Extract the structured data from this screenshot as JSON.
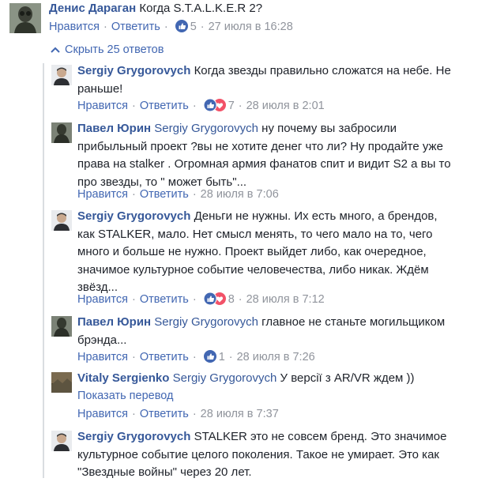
{
  "top_comment": {
    "author": "Денис Дараган",
    "text": "Когда S.T.A.L.K.E.R 2?",
    "like": "Нравится",
    "reply": "Ответить",
    "likes": "5",
    "time": "27 июля в 16:28"
  },
  "collapse_label": "Скрыть 25 ответов",
  "replies": [
    {
      "author": "Sergiy Grygorovych",
      "text": "Когда звезды правильно сложатся на небе. Не раньше!",
      "like": "Нравится",
      "reply": "Ответить",
      "likes": "7",
      "time": "28 июля в 2:01"
    },
    {
      "author": "Павел Юрин",
      "mention": "Sergiy Grygorovych",
      "text": "ну почему вы забросили прибыльный проект ?вы не хотите денег что ли? Ну продайте уже права на stalker . Огромная армия фанатов спит и видит S2 а вы то про звезды, то \" может быть\"...",
      "like": "Нравится",
      "reply": "Ответить",
      "time": "28 июля в 7:06"
    },
    {
      "author": "Sergiy Grygorovych",
      "text": "Деньги не нужны. Их есть много, а брендов, как STALKER, мало. Нет смысл менять, то чего мало на то, чего много и больше не нужно. Проект выйдет либо, как очередное, значимое культурное событие человечества, либо никак. Ждём звёзд...",
      "like": "Нравится",
      "reply": "Ответить",
      "likes": "8",
      "time": "28 июля в 7:12"
    },
    {
      "author": "Павел Юрин",
      "mention": "Sergiy Grygorovych",
      "text": "главное не станьте могильщиком брэнда...",
      "like": "Нравится",
      "reply": "Ответить",
      "likes": "1",
      "time": "28 июля в 7:26"
    },
    {
      "author": "Vitaly Sergienko",
      "mention": "Sergiy Grygorovych",
      "text": "У версії з AR/VR ждем ))",
      "translate": "Показать перевод",
      "like": "Нравится",
      "reply": "Ответить",
      "time": "28 июля в 7:37"
    },
    {
      "author": "Sergiy Grygorovych",
      "text": "STALKER это не совсем бренд. Это значимое культурное событие целого поколения. Такое не умирает. Это как \"Звездные войны\" через 20 лет."
    }
  ],
  "colors": {
    "link": "#4267b2",
    "name": "#365899",
    "meta": "#90949c",
    "like_blue": "#3b5998",
    "heart_red": "#f25268"
  }
}
